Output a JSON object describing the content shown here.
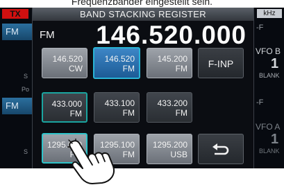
{
  "caption": "Frequenzbänder eingestellt sein.",
  "screen": {
    "tx_label": "TX",
    "unit_label": "kHz",
    "left_mode_top": "FM",
    "left_mode_bottom": "FM",
    "side_letter_1": "S",
    "side_label_po": "Po",
    "side_letter_2": "S",
    "right_f1": "-F",
    "right_f2": "-F",
    "vfo_b_label": "VFO B",
    "vfo_b_num": "1",
    "vfo_b_state": "BLANK",
    "vfo_a_label": "VFO A",
    "vfo_a_num": "1",
    "vfo_a_state": "BLANK"
  },
  "dialog": {
    "title": "BAND STACKING REGISTER",
    "mode": "FM",
    "frequency": "146.520.000",
    "rows": [
      [
        {
          "freq": "146.520",
          "mode": "CW",
          "style": "gray"
        },
        {
          "freq": "146.520",
          "mode": "FM",
          "style": "blue"
        },
        {
          "freq": "145.200",
          "mode": "FM",
          "style": "gray"
        }
      ],
      [
        {
          "freq": "433.000",
          "mode": "FM",
          "style": "darksel"
        },
        {
          "freq": "433.100",
          "mode": "FM",
          "style": "dark"
        },
        {
          "freq": "433.200",
          "mode": "FM",
          "style": "dark"
        }
      ],
      [
        {
          "freq": "1295.000",
          "mode": "FM",
          "style": "graysel"
        },
        {
          "freq": "1295.100",
          "mode": "FM",
          "style": "gray"
        },
        {
          "freq": "1295.200",
          "mode": "USB",
          "style": "gray"
        }
      ]
    ],
    "finp_label": "F-INP",
    "back_icon": "return-arrow-icon"
  }
}
